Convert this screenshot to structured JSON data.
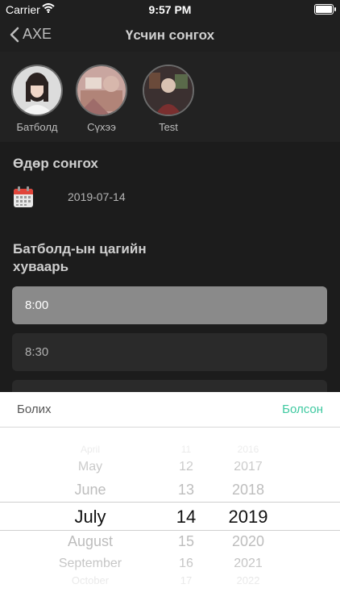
{
  "status_bar": {
    "carrier": "Carrier",
    "time": "9:57 PM"
  },
  "nav": {
    "back_label": "AXE",
    "title": "Үсчин сонгох"
  },
  "barbers": [
    {
      "name": "Батболд"
    },
    {
      "name": "Сүхээ"
    },
    {
      "name": "Test"
    }
  ],
  "day_section": {
    "title": "Өдөр сонгох",
    "date": "2019-07-14"
  },
  "schedule": {
    "title_line1": "Батболд-ын цагийн",
    "title_line2": "хуваарь",
    "slots": [
      "8:00",
      "8:30"
    ]
  },
  "sheet": {
    "cancel_label": "Болих",
    "done_label": "Болсон"
  },
  "picker": {
    "months": [
      "April",
      "May",
      "June",
      "July",
      "August",
      "September",
      "October"
    ],
    "days": [
      "11",
      "12",
      "13",
      "14",
      "15",
      "16",
      "17"
    ],
    "years": [
      "2016",
      "2017",
      "2018",
      "2019",
      "2020",
      "2021",
      "2022"
    ],
    "selected": {
      "month": "July",
      "day": "14",
      "year": "2019"
    }
  },
  "colors": {
    "accent": "#3ec9a0",
    "background": "#1f1f1f",
    "selected_slot": "#8a8a8a"
  }
}
